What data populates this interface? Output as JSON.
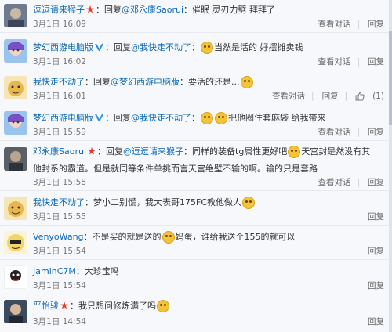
{
  "comments": [
    {
      "name": "逗逗请来猴子",
      "badge": "star",
      "prefix": "：回复",
      "at": "@邓永康Saorui",
      "text": "：催眠 灵刃力劈 拜拜了",
      "emojis": 0,
      "time": "3月1日 16:09",
      "actions": [
        "查看对话",
        "回复"
      ],
      "like": ""
    },
    {
      "name": "梦幻西游电脑版",
      "badge": "verified",
      "prefix": "：回复",
      "at": "@我快走不动了",
      "text": "当然是活的 好摆摊卖钱",
      "emojis": 1,
      "time": "3月1日 16:02",
      "actions": [
        "查看对话",
        "回复"
      ],
      "like": ""
    },
    {
      "name": "我快走不动了",
      "badge": "",
      "prefix": "：回复",
      "at": "@梦幻西游电脑版",
      "text": "：要活的还是...",
      "emojis": 1,
      "time": "3月1日 16:01",
      "actions": [
        "查看对话",
        "回复"
      ],
      "like": "(1)"
    },
    {
      "name": "梦幻西游电脑版",
      "badge": "verified",
      "prefix": "：回复",
      "at": "@我快走不动了",
      "text": "把他圈住套麻袋 给我带来",
      "emojis": 2,
      "time": "3月1日 15:59",
      "actions": [
        "查看对话",
        "回复"
      ],
      "like": ""
    },
    {
      "name": "邓永康Saorui",
      "badge": "star",
      "prefix": "：回复",
      "at": "@逗逗请来猴子",
      "text": "：同样的装备tg属性更好吧",
      "text2": "天宫封是然没有其他封系的霸道。但是就同等条件单挑而言天宫绝壁不输的啊。输的只是套路",
      "emojis": 1,
      "time": "3月1日 15:58",
      "actions": [
        "查看对话",
        "回复"
      ],
      "like": ""
    },
    {
      "name": "我快走不动了",
      "badge": "",
      "prefix": "：",
      "at": "",
      "text": "梦小二别慌，我大表哥175FC教他做人",
      "emojis": 1,
      "time": "3月1日 15:55",
      "actions": [
        "回复"
      ],
      "like": ""
    },
    {
      "name": "VenyoWang",
      "badge": "",
      "prefix": "：",
      "at": "",
      "text": "不是买的就是送的",
      "text2": "妈蛋，谁给我送个155的就可以",
      "emojis": 1,
      "time": "3月1日 15:54",
      "actions": [
        "回复"
      ],
      "like": ""
    },
    {
      "name": "JaminC7M",
      "badge": "",
      "prefix": "：",
      "at": "",
      "text": "大珍宝吗",
      "emojis": 0,
      "time": "3月1日 15:54",
      "actions": [
        "回复"
      ],
      "like": ""
    },
    {
      "name": "严怡骏",
      "badge": "star",
      "prefix": "：",
      "at": "",
      "text": "我只想问修炼满了吗",
      "emojis": 1,
      "time": "3月1日 14:54",
      "actions": [
        "回复"
      ],
      "like": ""
    }
  ],
  "colors": {
    "link": "#0e6ab8",
    "star": "#e8382a",
    "verified": "#2d8be0"
  }
}
